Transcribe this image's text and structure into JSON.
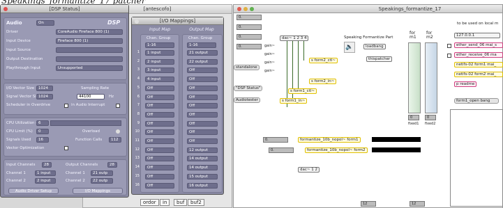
{
  "top_caption": "Speakings_formantize_17 patcher",
  "antescofo_window": {
    "title": "[antescofo]",
    "bottom_tabs": [
      "ordor",
      "in",
      "buf",
      "buf2"
    ]
  },
  "dsp": {
    "title": "[DSP Status]",
    "audio_label": "Audio",
    "audio_value": "On",
    "dsp_label": "DSP",
    "rows": [
      {
        "label": "Driver",
        "value": "CoreAudio Fireface 800 (1)"
      },
      {
        "label": "Input Device",
        "value": "Fireface 800 (1)"
      },
      {
        "label": "Input Source",
        "value": ""
      },
      {
        "label": "Output Destination",
        "value": ""
      },
      {
        "label": "Playthrough Input",
        "value": "Unsupported"
      }
    ],
    "vector": {
      "io_label": "I/O Vector Size",
      "io_value": "1024",
      "sig_label": "Signal Vector Size",
      "sig_value": "1024",
      "sr_label": "Sampling Rate",
      "sr_value": "44100",
      "sr_unit": "Hz",
      "overdrive_label": "Scheduler in Overdrive",
      "interrupt_label": "in Audio Interrupt"
    },
    "stats": {
      "cpu_util_label": "CPU Utilization (%)",
      "cpu_util_value": "6",
      "cpu_limit_label": "CPU Limit (%)",
      "cpu_limit_value": "0",
      "overload_label": "Overload",
      "signals_label": "Signals Used",
      "signals_value": "16",
      "calls_label": "Function Calls",
      "calls_value": "112",
      "vopt_label": "Vector Optimization"
    },
    "channels": {
      "in_label": "Input Channels",
      "in_value": "28",
      "out_label": "Output Channels",
      "out_value": "28",
      "rows": [
        {
          "label": "Channel 1",
          "value": "1 input",
          "olabel": "Channel 1",
          "ovalue": "21 outp"
        },
        {
          "label": "Channel 2",
          "value": "2 input",
          "olabel": "Channel 2",
          "ovalue": "22 outp"
        }
      ]
    },
    "buttons": {
      "driver_setup": "Audio Driver Setup",
      "io_mappings": "I/O Mappings"
    }
  },
  "io": {
    "title": "[I/O Mappings]",
    "input_map": "Input Map",
    "output_map": "Output Map",
    "chan_group": "Chan. Group",
    "group_value": "1-16",
    "inputs": [
      "1 input",
      "2 input",
      "3 input",
      "4 input",
      "Off",
      "Off",
      "Off",
      "Off",
      "Off",
      "Off",
      "Off",
      "Off",
      "Off",
      "Off",
      "Off",
      "Off"
    ],
    "outputs": [
      "21 output",
      "22 output",
      "Off",
      "Off",
      "Off",
      "Off",
      "Off",
      "Off",
      "Off",
      "Off",
      "Off",
      "12 output",
      "14 output",
      "14 output",
      "15 output",
      "16 output"
    ]
  },
  "speakings": {
    "title": "Speakings_formantize_17",
    "note": "to be used on local m",
    "left_numbers": [
      "0.",
      "0.",
      "0.",
      "0."
    ],
    "standalone": "standalone",
    "dsp_status": "\"DSP Status\"",
    "audiotester": "Audiotester",
    "dac_top": "dac~ 1 2 3 4",
    "gains": [
      "gain~",
      "gain~",
      "gain~",
      "gain~"
    ],
    "forms": [
      "s form2_ctl~",
      "s form2_in~",
      "s form1_ctl~",
      "s form1_in~"
    ],
    "part_label": "Speaking Formantize Part",
    "loadbang": "loadbang",
    "thispatcher": "thispatcher",
    "fader_labels": [
      "for m1",
      "for m2"
    ],
    "fader_values": [
      "0",
      "0"
    ],
    "fader_bottom": [
      "fixed1",
      "fixed2"
    ],
    "right_num": "127.0.0.1",
    "right_msgs": [
      "ether_send_06 mai_s",
      "ether_receive_06 ma",
      "netifs-02 form1 mai_",
      "netifs-02 form2 mai_",
      "p readme"
    ],
    "open_bang": "form1_open bang",
    "formantize1": "formantize_10b_nopol~ form1",
    "formantize2": "formantize_10b_nopol~ form2",
    "mid_numbers": [
      "0.",
      "0."
    ],
    "dac_bottom": "dac~ 1 2",
    "bottom_nums": [
      "12",
      "12"
    ]
  }
}
